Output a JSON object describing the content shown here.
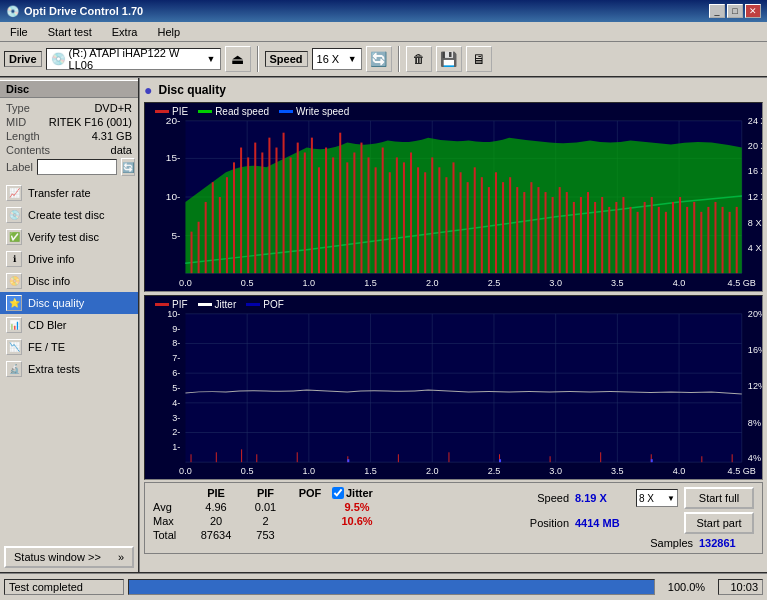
{
  "titleBar": {
    "title": "Opti Drive Control 1.70",
    "icon": "💿",
    "buttons": [
      "_",
      "□",
      "✕"
    ]
  },
  "menuBar": {
    "items": [
      "File",
      "Start test",
      "Extra",
      "Help"
    ]
  },
  "toolbar": {
    "driveLabel": "Drive",
    "driveValue": "(R:) ATAPI iHAP122  W LL06",
    "speedLabel": "Speed",
    "speedValue": "16 X",
    "buttons": [
      "⬆",
      "🔄",
      "💾",
      "📊",
      "🖥"
    ]
  },
  "sidebar": {
    "discSection": "Disc",
    "discInfo": {
      "type": {
        "label": "Type",
        "value": "DVD+R"
      },
      "mid": {
        "label": "MID",
        "value": "RITEK F16 (001)"
      },
      "length": {
        "label": "Length",
        "value": "4.31 GB"
      },
      "contents": {
        "label": "Contents",
        "value": "data"
      },
      "labelField": ""
    },
    "navItems": [
      {
        "id": "transfer-rate",
        "label": "Transfer rate",
        "icon": "📈"
      },
      {
        "id": "create-test-disc",
        "label": "Create test disc",
        "icon": "💿"
      },
      {
        "id": "verify-test-disc",
        "label": "Verify test disc",
        "icon": "✅"
      },
      {
        "id": "drive-info",
        "label": "Drive info",
        "icon": "ℹ"
      },
      {
        "id": "disc-info",
        "label": "Disc info",
        "icon": "📀"
      },
      {
        "id": "disc-quality",
        "label": "Disc quality",
        "icon": "⭐",
        "active": true
      },
      {
        "id": "cd-bler",
        "label": "CD Bler",
        "icon": "📊"
      },
      {
        "id": "fe-te",
        "label": "FE / TE",
        "icon": "📉"
      },
      {
        "id": "extra-tests",
        "label": "Extra tests",
        "icon": "🔬"
      }
    ],
    "statusWindowBtn": "Status window >>"
  },
  "contentArea": {
    "title": "Disc quality",
    "chart1": {
      "legend": [
        {
          "label": "PIE",
          "color": "#cc0000"
        },
        {
          "label": "Read speed",
          "color": "#00cc00"
        },
        {
          "label": "Write speed",
          "color": "#0000cc"
        }
      ],
      "yAxisLabels": [
        "20-",
        "15-",
        "10-",
        "5-"
      ],
      "yAxisRight": [
        "24X",
        "20X",
        "16X",
        "12X",
        "8X",
        "4X"
      ],
      "xAxisLabels": [
        "0.0",
        "0.5",
        "1.0",
        "1.5",
        "2.0",
        "2.5",
        "3.0",
        "3.5",
        "4.0",
        "4.5 GB"
      ]
    },
    "chart2": {
      "legend": [
        {
          "label": "PIF",
          "color": "#cc0000"
        },
        {
          "label": "Jitter",
          "color": "#ffffff"
        },
        {
          "label": "POF",
          "color": "#000066"
        }
      ],
      "yAxisLabels": [
        "10-",
        "9-",
        "8-",
        "7-",
        "6-",
        "5-",
        "4-",
        "3-",
        "2-",
        "1-"
      ],
      "yAxisRight": [
        "20%",
        "16%",
        "12%",
        "8%",
        "4%"
      ],
      "xAxisLabels": [
        "0.0",
        "0.5",
        "1.0",
        "1.5",
        "2.0",
        "2.5",
        "3.0",
        "3.5",
        "4.0",
        "4.5 GB"
      ]
    }
  },
  "statsBar": {
    "columns": [
      "PIE",
      "PIF",
      "POF",
      "Jitter"
    ],
    "jitterChecked": true,
    "rows": [
      {
        "label": "Avg",
        "pie": "4.96",
        "pif": "0.01",
        "pof": "",
        "jitter": "9.5%"
      },
      {
        "label": "Max",
        "pie": "20",
        "pif": "2",
        "pof": "",
        "jitter": "10.6%"
      },
      {
        "label": "Total",
        "pie": "87634",
        "pif": "753",
        "pof": "",
        "jitter": ""
      }
    ],
    "rightPanel": {
      "speed": {
        "label": "Speed",
        "value": "8.19 X",
        "combo": "8 X"
      },
      "position": {
        "label": "Position",
        "value": "4414 MB"
      },
      "samples": {
        "label": "Samples",
        "value": "132861"
      }
    },
    "buttons": [
      "Start full",
      "Start part"
    ]
  },
  "statusBar": {
    "text": "Test completed",
    "progress": 100,
    "progressLabel": "100.0%",
    "time": "10:03"
  }
}
